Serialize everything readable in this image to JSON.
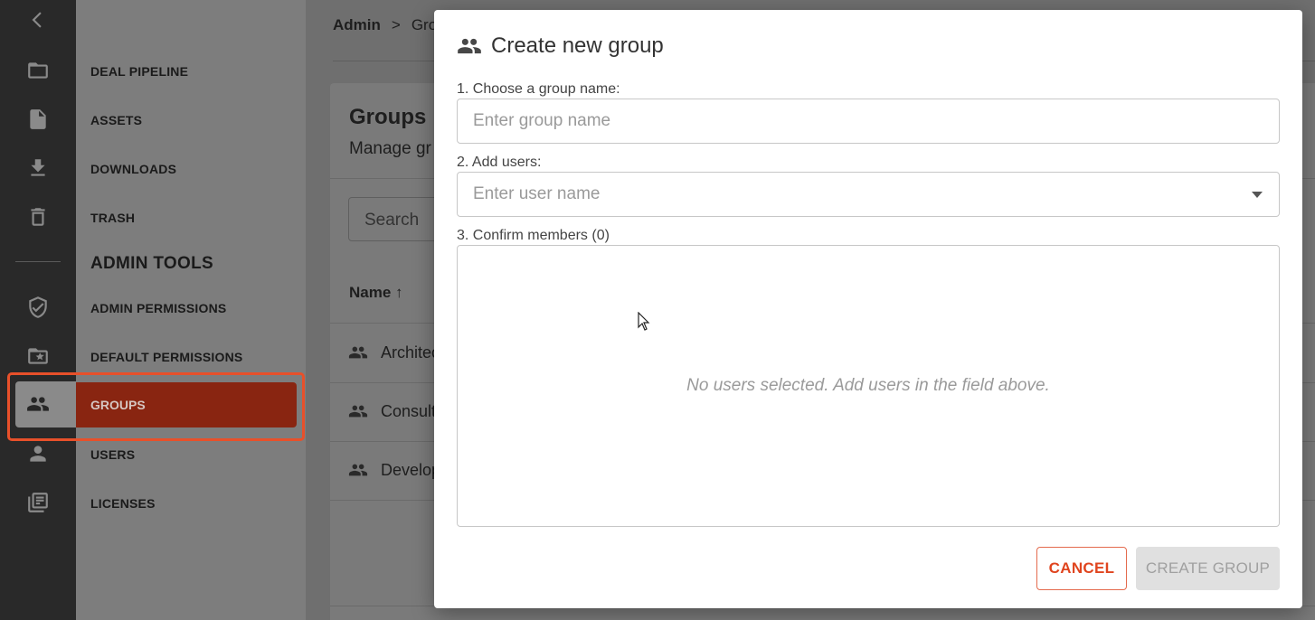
{
  "nav": {
    "items": [
      {
        "label": "DEAL PIPELINE"
      },
      {
        "label": "ASSETS"
      },
      {
        "label": "DOWNLOADS"
      },
      {
        "label": "TRASH"
      }
    ],
    "admin_heading": "ADMIN TOOLS",
    "admin_items": [
      {
        "label": "ADMIN PERMISSIONS"
      },
      {
        "label": "DEFAULT PERMISSIONS"
      },
      {
        "label": "GROUPS",
        "active": true
      },
      {
        "label": "USERS"
      },
      {
        "label": "LICENSES"
      }
    ]
  },
  "rail": {
    "icons": [
      "chevron-left-icon",
      "folder-icon",
      "file-icon",
      "download-icon",
      "trash-icon",
      "shield-check-icon",
      "folder-star-icon",
      "users-icon",
      "user-icon",
      "library-icon"
    ]
  },
  "breadcrumb": {
    "root": "Admin",
    "separator": ">",
    "current": "Gro"
  },
  "page": {
    "title": "Groups",
    "subtitle": "Manage gr",
    "search_label": "Search",
    "column_name": "Name ↑",
    "rows": [
      {
        "name": "Architec"
      },
      {
        "name": "Consult"
      },
      {
        "name": "Develop"
      }
    ]
  },
  "modal": {
    "title": "Create new group",
    "step1_label": "1. Choose a group name:",
    "group_name_placeholder": "Enter group name",
    "group_name_value": "",
    "step2_label": "2. Add users:",
    "user_name_placeholder": "Enter user name",
    "user_name_value": "",
    "step3_label": "3. Confirm members (0)",
    "empty_message": "No users selected. Add users in the field above.",
    "cancel_label": "CANCEL",
    "create_label": "CREATE GROUP"
  },
  "colors": {
    "accent": "#e0451f",
    "active_nav": "#892511",
    "highlight_border": "#e8502a",
    "rail_bg": "#292929"
  }
}
